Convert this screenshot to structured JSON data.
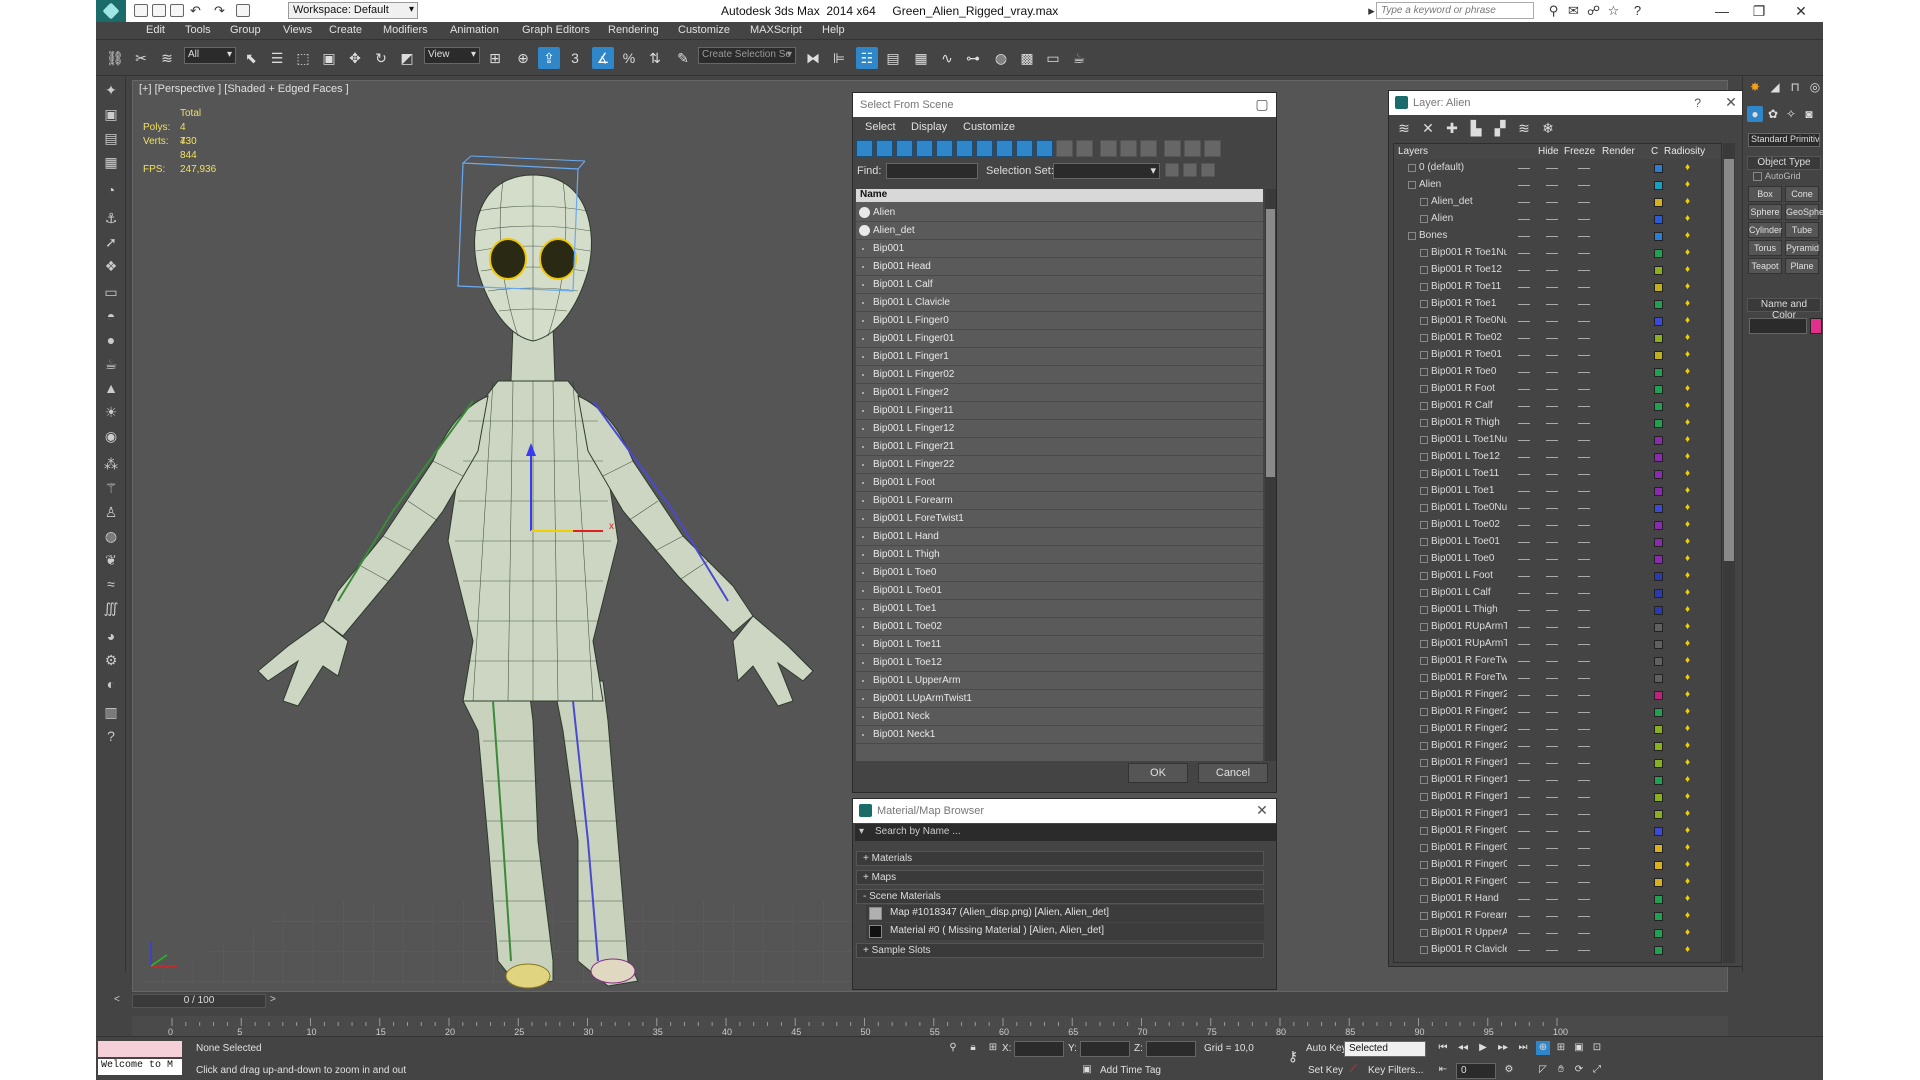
{
  "title_bar": {
    "workspace": "Workspace: Default",
    "window_title": "Autodesk 3ds Max  2014 x64     Green_Alien_Rigged_vray.max",
    "search_placeholder": "Type a keyword or phrase"
  },
  "menu": [
    "Edit",
    "Tools",
    "Group",
    "Views",
    "Create",
    "Modifiers",
    "Animation",
    "Graph Editors",
    "Rendering",
    "Customize",
    "MAXScript",
    "Help"
  ],
  "toolbar": {
    "filter": "All",
    "ref_coord": "View",
    "selection_set": "Create Selection Se"
  },
  "viewport": {
    "label": "[+] [Perspective ] [Shaded + Edged Faces ]",
    "stats": {
      "total_label": "Total",
      "polys_label": "Polys:",
      "polys": "4 730",
      "verts_label": "Verts:",
      "verts": "4 844",
      "fps_label": "FPS:",
      "fps": "247,936"
    },
    "gizmo": {
      "x": "x",
      "y": "y",
      "z": "z"
    }
  },
  "select_from_scene": {
    "title": "Select From Scene",
    "menus": [
      "Select",
      "Display",
      "Customize"
    ],
    "find_label": "Find:",
    "selection_set_label": "Selection Set:",
    "column": "Name",
    "items": [
      "Alien",
      "Alien_det",
      "Bip001",
      "Bip001 Head",
      "Bip001 L Calf",
      "Bip001 L Clavicle",
      "Bip001 L Finger0",
      "Bip001 L Finger01",
      "Bip001 L Finger1",
      "Bip001 L Finger02",
      "Bip001 L Finger2",
      "Bip001 L Finger11",
      "Bip001 L Finger12",
      "Bip001 L Finger21",
      "Bip001 L Finger22",
      "Bip001 L Foot",
      "Bip001 L Forearm",
      "Bip001 L ForeTwist1",
      "Bip001 L Hand",
      "Bip001 L Thigh",
      "Bip001 L Toe0",
      "Bip001 L Toe01",
      "Bip001 L Toe1",
      "Bip001 L Toe02",
      "Bip001 L Toe11",
      "Bip001 L Toe12",
      "Bip001 L UpperArm",
      "Bip001 LUpArmTwist1",
      "Bip001 Neck",
      "Bip001 Neck1"
    ],
    "ok": "OK",
    "cancel": "Cancel"
  },
  "material_browser": {
    "title": "Material/Map Browser",
    "search_placeholder": "Search by Name ...",
    "groups": [
      "+ Materials",
      "+ Maps",
      "- Scene Materials"
    ],
    "items": [
      "Map #1018347 (Alien_disp.png)  [Alien, Alien_det]",
      "Material #0  ( Missing Material )  [Alien, Alien_det]"
    ],
    "sample_slots": "+ Sample Slots"
  },
  "layer_panel": {
    "title": "Layer: Alien",
    "help": "?",
    "columns": [
      "Layers",
      "Hide",
      "Freeze",
      "Render",
      "C",
      "Radiosity"
    ],
    "rows": [
      {
        "name": "0 (default)",
        "indent": 0,
        "color": "#2a7fd4"
      },
      {
        "name": "Alien",
        "indent": 0,
        "color": "#18a0c0"
      },
      {
        "name": "Alien_det",
        "indent": 1,
        "color": "#d8b020"
      },
      {
        "name": "Alien",
        "indent": 1,
        "color": "#2a5ad4"
      },
      {
        "name": "Bones",
        "indent": 0,
        "color": "#2a7fd4"
      },
      {
        "name": "Bip001 R Toe1Nu",
        "indent": 1,
        "color": "#20a050"
      },
      {
        "name": "Bip001 R Toe12",
        "indent": 1,
        "color": "#8ab020"
      },
      {
        "name": "Bip001 R Toe11",
        "indent": 1,
        "color": "#c0b020"
      },
      {
        "name": "Bip001 R Toe1",
        "indent": 1,
        "color": "#20a050"
      },
      {
        "name": "Bip001 R Toe0Nu",
        "indent": 1,
        "color": "#3a4ad4"
      },
      {
        "name": "Bip001 R Toe02",
        "indent": 1,
        "color": "#8ab020"
      },
      {
        "name": "Bip001 R Toe01",
        "indent": 1,
        "color": "#c0b020"
      },
      {
        "name": "Bip001 R Toe0",
        "indent": 1,
        "color": "#20a050"
      },
      {
        "name": "Bip001 R Foot",
        "indent": 1,
        "color": "#20a050"
      },
      {
        "name": "Bip001 R Calf",
        "indent": 1,
        "color": "#20a050"
      },
      {
        "name": "Bip001 R Thigh",
        "indent": 1,
        "color": "#20a050"
      },
      {
        "name": "Bip001 L Toe1Nu",
        "indent": 1,
        "color": "#8a2ab0"
      },
      {
        "name": "Bip001 L Toe12",
        "indent": 1,
        "color": "#8a2ab0"
      },
      {
        "name": "Bip001 L Toe11",
        "indent": 1,
        "color": "#8a2ab0"
      },
      {
        "name": "Bip001 L Toe1",
        "indent": 1,
        "color": "#8a2ab0"
      },
      {
        "name": "Bip001 L Toe0Nu",
        "indent": 1,
        "color": "#3a4ad4"
      },
      {
        "name": "Bip001 L Toe02",
        "indent": 1,
        "color": "#8a2ab0"
      },
      {
        "name": "Bip001 L Toe01",
        "indent": 1,
        "color": "#8a2ab0"
      },
      {
        "name": "Bip001 L Toe0",
        "indent": 1,
        "color": "#8a2ab0"
      },
      {
        "name": "Bip001 L Foot",
        "indent": 1,
        "color": "#2a3ab0"
      },
      {
        "name": "Bip001 L Calf",
        "indent": 1,
        "color": "#2a3ab0"
      },
      {
        "name": "Bip001 L Thigh",
        "indent": 1,
        "color": "#2a3ab0"
      },
      {
        "name": "Bip001 RUpArmT",
        "indent": 1,
        "color": "#606060"
      },
      {
        "name": "Bip001 RUpArmT",
        "indent": 1,
        "color": "#606060"
      },
      {
        "name": "Bip001 R ForeTw",
        "indent": 1,
        "color": "#606060"
      },
      {
        "name": "Bip001 R ForeTw",
        "indent": 1,
        "color": "#606060"
      },
      {
        "name": "Bip001 R Finger2",
        "indent": 1,
        "color": "#c02080"
      },
      {
        "name": "Bip001 R Finger2",
        "indent": 1,
        "color": "#20a050"
      },
      {
        "name": "Bip001 R Finger2",
        "indent": 1,
        "color": "#8ab020"
      },
      {
        "name": "Bip001 R Finger2",
        "indent": 1,
        "color": "#8ab020"
      },
      {
        "name": "Bip001 R Finger1",
        "indent": 1,
        "color": "#8ab020"
      },
      {
        "name": "Bip001 R Finger1",
        "indent": 1,
        "color": "#20a050"
      },
      {
        "name": "Bip001 R Finger1",
        "indent": 1,
        "color": "#8ab020"
      },
      {
        "name": "Bip001 R Finger1",
        "indent": 1,
        "color": "#8ab020"
      },
      {
        "name": "Bip001 R Finger0",
        "indent": 1,
        "color": "#3a4ad4"
      },
      {
        "name": "Bip001 R Finger0",
        "indent": 1,
        "color": "#d8b020"
      },
      {
        "name": "Bip001 R Finger0",
        "indent": 1,
        "color": "#d8b020"
      },
      {
        "name": "Bip001 R Finger0",
        "indent": 1,
        "color": "#d8b020"
      },
      {
        "name": "Bip001 R Hand",
        "indent": 1,
        "color": "#20a050"
      },
      {
        "name": "Bip001 R Forearm",
        "indent": 1,
        "color": "#20a050"
      },
      {
        "name": "Bip001 R UpperA",
        "indent": 1,
        "color": "#20a050"
      },
      {
        "name": "Bip001 R Clavicle",
        "indent": 1,
        "color": "#20a050"
      }
    ]
  },
  "command_panel": {
    "primitive_type": "Standard Primitives",
    "object_type": "Object Type",
    "autogrid": "AutoGrid",
    "primitives": [
      "Box",
      "Cone",
      "Sphere",
      "GeoSphere",
      "Cylinder",
      "Tube",
      "Torus",
      "Pyramid",
      "Teapot",
      "Plane"
    ],
    "name_and_color": "Name and Color",
    "object_color": "#e0308c"
  },
  "timeline": {
    "position": "0 / 100",
    "ticks": [
      "0",
      "5",
      "10",
      "15",
      "20",
      "25",
      "30",
      "35",
      "40",
      "45",
      "50",
      "55",
      "60",
      "65",
      "70",
      "75",
      "80",
      "85",
      "90",
      "95",
      "100"
    ]
  },
  "status": {
    "welcome": "Welcome to M",
    "selection": "None Selected",
    "prompt": "Click and drag up-and-down to zoom in and out",
    "x_label": "X:",
    "y_label": "Y:",
    "z_label": "Z:",
    "grid": "Grid = 10,0",
    "add_time_tag": "Add Time Tag",
    "auto_key": "Auto Key",
    "set_key": "Set Key",
    "key_mode": "Selected",
    "key_filters": "Key Filters...",
    "frame": "0"
  }
}
